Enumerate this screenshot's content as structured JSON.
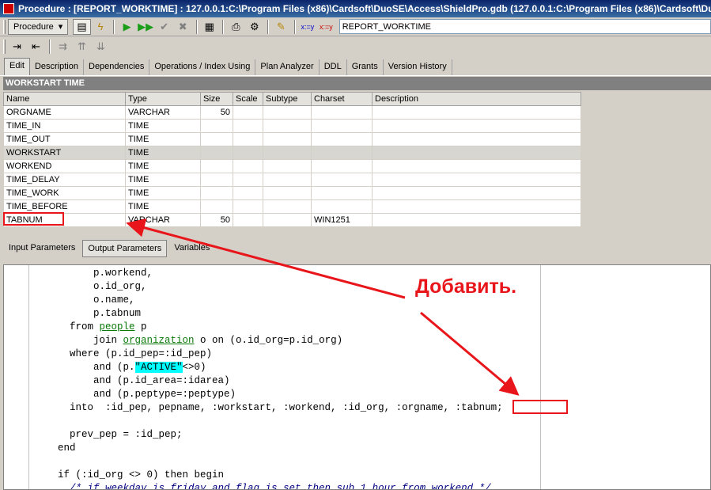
{
  "window": {
    "title": "Procedure : [REPORT_WORKTIME] : 127.0.0.1:C:\\Program Files (x86)\\Cardsoft\\DuoSE\\Access\\ShieldPro.gdb (127.0.0.1:C:\\Program Files (x86)\\Cardsoft\\DuoS"
  },
  "toolbar": {
    "dropdown_label": "Procedure",
    "procedure_name": "REPORT_WORKTIME"
  },
  "tabs": [
    "Edit",
    "Description",
    "Dependencies",
    "Operations / Index Using",
    "Plan Analyzer",
    "DDL",
    "Grants",
    "Version History"
  ],
  "section_header": "WORKSTART TIME",
  "columns": [
    "Name",
    "Type",
    "Size",
    "Scale",
    "Subtype",
    "Charset",
    "Description"
  ],
  "rows": [
    {
      "name": "ORGNAME",
      "type": "VARCHAR",
      "size": "50",
      "charset": ""
    },
    {
      "name": "TIME_IN",
      "type": "TIME",
      "size": "",
      "charset": ""
    },
    {
      "name": "TIME_OUT",
      "type": "TIME",
      "size": "",
      "charset": ""
    },
    {
      "name": "WORKSTART",
      "type": "TIME",
      "size": "",
      "charset": ""
    },
    {
      "name": "WORKEND",
      "type": "TIME",
      "size": "",
      "charset": ""
    },
    {
      "name": "TIME_DELAY",
      "type": "TIME",
      "size": "",
      "charset": ""
    },
    {
      "name": "TIME_WORK",
      "type": "TIME",
      "size": "",
      "charset": ""
    },
    {
      "name": "TIME_BEFORE",
      "type": "TIME",
      "size": "",
      "charset": ""
    },
    {
      "name": "TABNUM",
      "type": "VARCHAR",
      "size": "50",
      "charset": "WIN1251"
    }
  ],
  "param_tabs": [
    "Input Parameters",
    "Output Parameters",
    "Variables"
  ],
  "code": {
    "l1": "          p.workend,",
    "l2": "          o.id_org,",
    "l3": "          o.name,",
    "l4": "          p.tabnum",
    "l5_a": "      from ",
    "l5_t": "people",
    "l5_b": " p",
    "l6_a": "          join ",
    "l6_t": "organization",
    "l6_b": " o on (o.id_org=p.id_org)",
    "l7": "      where (p.id_pep=:id_pep)",
    "l8_a": "          and (p.",
    "l8_h": "\"ACTIVE\"",
    "l8_b": "<>0)",
    "l9": "          and (p.id_area=:idarea)",
    "l10": "          and (p.peptype=:peptype)",
    "l11": "      into  :id_pep, pepname, :workstart, :workend, :id_org, :orgname, :tabnum;",
    "l12": "",
    "l13": "      prev_pep = :id_pep;",
    "l14": "    end",
    "l15": "",
    "l16": "    if (:id_org <> 0) then begin",
    "l17": "      /* if weekday is friday and flag is set then sub 1 hour from workend */"
  },
  "annotation": "Добавить.",
  "colors": {
    "accent": "#e8161b",
    "highlight": "#00ffff",
    "table_link": "#0a7a0a"
  }
}
